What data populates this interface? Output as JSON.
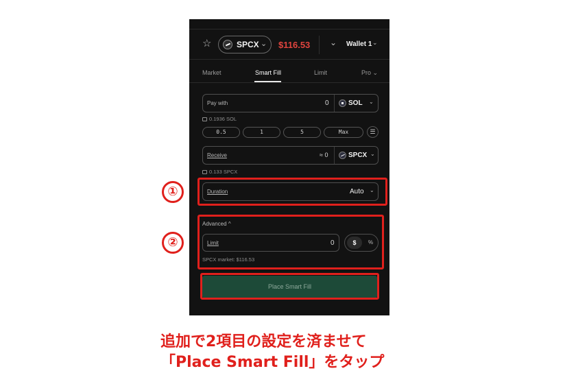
{
  "header": {
    "star_icon": "star-icon",
    "token": "SPCX",
    "price": "$116.53",
    "wallet": "Wallet 1",
    "price_color": "#e0443e"
  },
  "tabs": [
    {
      "label": "Market"
    },
    {
      "label": "Smart Fill"
    },
    {
      "label": "Limit"
    },
    {
      "label": "Pro"
    }
  ],
  "pay": {
    "label": "Pay with",
    "value": "0",
    "token": "SOL",
    "balance": "0.1936 SOL"
  },
  "quick_amounts": [
    "0.5",
    "1",
    "5",
    "Max"
  ],
  "receive": {
    "label": "Receive",
    "value": "≈ 0",
    "token": "SPCX",
    "balance": "0.133 SPCX"
  },
  "duration": {
    "label": "Duration",
    "value": "Auto"
  },
  "advanced": {
    "label": "Advanced",
    "limit_label": "Limit",
    "limit_value": "0",
    "toggle_options": [
      "$",
      "%"
    ],
    "market_note": "SPCX market: $116.53"
  },
  "submit_label": "Place Smart Fill",
  "annotations": {
    "marker_1": "①",
    "marker_2": "②",
    "caption_line1": "追加で2項目の設定を済ませて",
    "caption_line2": "「Place Smart Fill」をタップ",
    "accent_color": "#e0201c"
  }
}
